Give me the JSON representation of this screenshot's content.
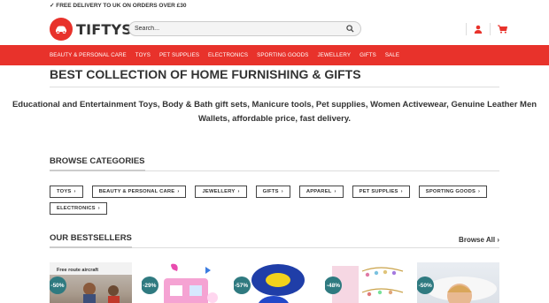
{
  "topbar": {
    "notice": "✓ FREE DELIVERY TO UK ON ORDERS OVER £30"
  },
  "header": {
    "logo_text": "TIFTYS",
    "search_placeholder": "Search..."
  },
  "nav": [
    "BEAUTY & PERSONAL CARE",
    "TOYS",
    "PET SUPPLIES",
    "ELECTRONICS",
    "SPORTING GOODS",
    "JEWELLERY",
    "GIFTS",
    "SALE"
  ],
  "hero": {
    "title": "BEST COLLECTION OF HOME FURNISHING & GIFTS",
    "intro": "Educational and Entertainment Toys, Body & Bath gift sets, Manicure tools, Pet supplies, Women Activewear, Genuine Leather Men Wallets, affordable price, fast delivery."
  },
  "categories": {
    "title": "BROWSE CATEGORIES",
    "items": [
      "TOYS",
      "BEAUTY & PERSONAL CARE",
      "JEWELLERY",
      "GIFTS",
      "APPAREL",
      "PET SUPPLIES",
      "SPORTING GOODS",
      "ELECTRONICS"
    ]
  },
  "bestsellers": {
    "title": "OUR BESTSELLERS",
    "browse_all": "Browse All",
    "products": [
      {
        "badge": "-50%",
        "caption": "Free route aircraft"
      },
      {
        "badge": "-29%"
      },
      {
        "badge": "-57%"
      },
      {
        "badge": "-48%"
      },
      {
        "badge": "-50%"
      }
    ]
  },
  "colors": {
    "brand": "#e8322b",
    "badge": "#2f7a80"
  }
}
